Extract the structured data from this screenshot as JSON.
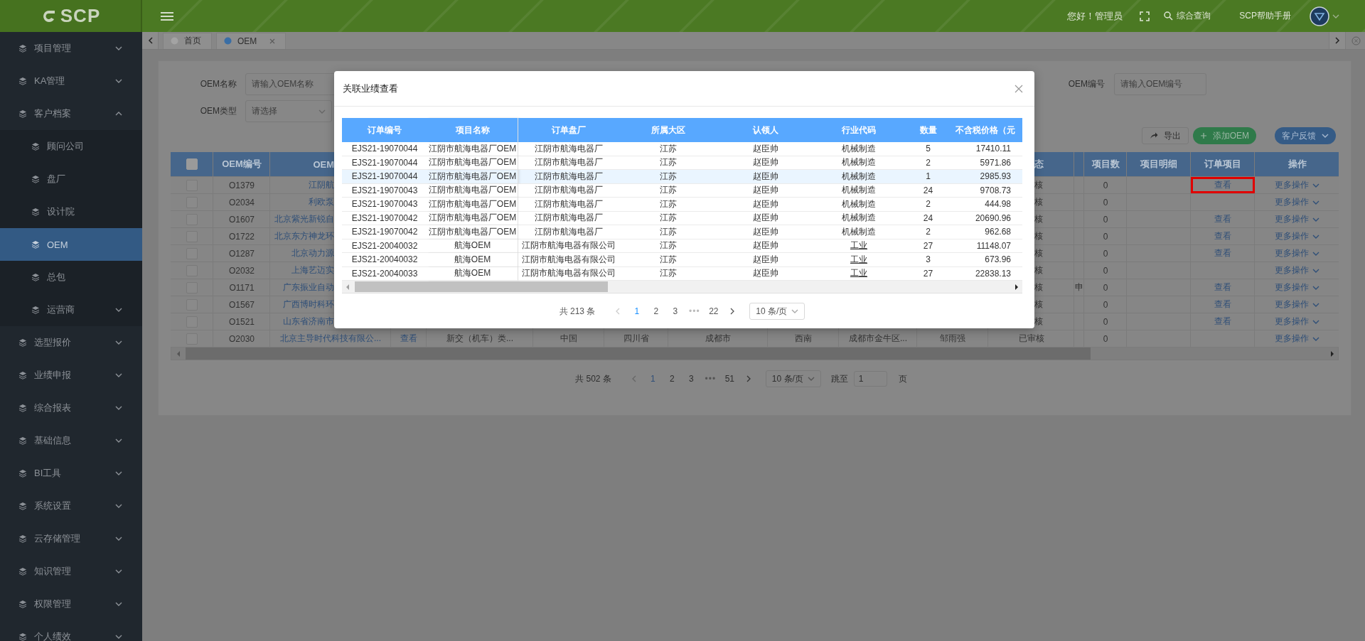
{
  "logo": {
    "text": "SCP"
  },
  "header": {
    "greeting": "您好！管理员",
    "search_label": "综合查询",
    "help_link": "SCP帮助手册"
  },
  "sidebar": {
    "items": [
      {
        "label": "项目管理",
        "expanded": false,
        "selected": false
      },
      {
        "label": "KA管理",
        "expanded": false,
        "selected": false
      },
      {
        "label": "客户档案",
        "expanded": true,
        "selected": false,
        "children": [
          {
            "label": "顾问公司",
            "selected": false
          },
          {
            "label": "盘厂",
            "selected": false
          },
          {
            "label": "设计院",
            "selected": false
          },
          {
            "label": "OEM",
            "selected": true
          },
          {
            "label": "总包",
            "selected": false
          },
          {
            "label": "运营商",
            "expanded": false,
            "selected": false
          }
        ]
      },
      {
        "label": "选型报价",
        "expanded": false,
        "selected": false
      },
      {
        "label": "业绩申报",
        "expanded": false,
        "selected": false
      },
      {
        "label": "综合报表",
        "expanded": false,
        "selected": false
      },
      {
        "label": "基础信息",
        "expanded": false,
        "selected": false
      },
      {
        "label": "BI工具",
        "expanded": false,
        "selected": false
      },
      {
        "label": "系统设置",
        "expanded": false,
        "selected": false
      },
      {
        "label": "云存储管理",
        "expanded": false,
        "selected": false
      },
      {
        "label": "知识管理",
        "expanded": false,
        "selected": false
      },
      {
        "label": "权限管理",
        "expanded": false,
        "selected": false
      },
      {
        "label": "个人绩效",
        "expanded": false,
        "selected": false
      }
    ]
  },
  "tabs": [
    {
      "label": "首页",
      "selected": false,
      "closable": false
    },
    {
      "label": "OEM",
      "selected": true,
      "closable": true
    }
  ],
  "filters": [
    {
      "label": "OEM名称",
      "placeholder": "请输入OEM名称",
      "kind": "input"
    },
    {
      "label": "OEM类型",
      "placeholder": "请选择",
      "kind": "select"
    },
    {
      "label": "OEM编号",
      "placeholder": "请输入OEM编号",
      "kind": "input"
    }
  ],
  "toolbar": {
    "buttons": [
      {
        "label": "导出",
        "kind": "export"
      },
      {
        "label": "添加OEM",
        "kind": "add"
      },
      {
        "label": "客户反馈",
        "kind": "dropdown"
      }
    ]
  },
  "table": {
    "header": {
      "select_all_checked": false,
      "oem_no": "OEM编号",
      "oem_name": "OEM",
      "status": "态",
      "project_count": "项目数",
      "project_detail": "项目明细",
      "order_items": "订单项目",
      "action": "操作"
    },
    "rows": [
      {
        "kind": "covered",
        "checked": false,
        "oem_no": "O1379",
        "oem_name": "江阴航",
        "status": "核",
        "project_count": "0",
        "order_items": "查看",
        "order_link_highlighted": true,
        "action": "更多操作"
      },
      {
        "kind": "covered",
        "checked": false,
        "oem_no": "O2034",
        "oem_name": "利欧泵",
        "status": "核",
        "project_count": "0",
        "order_link_highlighted": false,
        "action": "更多操作"
      },
      {
        "kind": "covered",
        "checked": false,
        "oem_no": "O1607",
        "oem_name": "北京紫光新锐自",
        "status": "核",
        "project_count": "0",
        "order_items": "查看",
        "order_link_highlighted": false,
        "action": "更多操作"
      },
      {
        "kind": "covered",
        "checked": false,
        "oem_no": "O1722",
        "oem_name": "北京东方神龙环",
        "status": "核",
        "project_count": "0",
        "order_items": "查看",
        "order_link_highlighted": false,
        "action": "更多操作"
      },
      {
        "kind": "covered",
        "checked": false,
        "oem_no": "O1287",
        "oem_name": "北京动力源",
        "status": "核",
        "project_count": "0",
        "order_items": "查看",
        "order_link_highlighted": false,
        "action": "更多操作"
      },
      {
        "kind": "covered",
        "checked": false,
        "oem_no": "O2032",
        "oem_name": "上海艺迈实",
        "status": "核",
        "project_count": "0",
        "order_link_highlighted": false,
        "action": "更多操作"
      },
      {
        "kind": "covered",
        "checked": false,
        "oem_no": "O1171",
        "oem_name": "广东振业自动",
        "status": "核",
        "column_13": "申",
        "project_count": "0",
        "order_items": "查看",
        "order_link_highlighted": false,
        "action": "更多操作"
      },
      {
        "kind": "covered",
        "checked": false,
        "oem_no": "O1567",
        "oem_name": "广西博时科环",
        "status": "核",
        "project_count": "0",
        "order_items": "查看",
        "order_link_highlighted": false,
        "action": "更多操作"
      },
      {
        "kind": "covered",
        "checked": false,
        "oem_no": "O1521",
        "oem_name": "山东省济南市",
        "status": "核",
        "project_count": "0",
        "order_items": "查看",
        "order_link_highlighted": false,
        "action": "更多操作"
      },
      {
        "kind": "full",
        "checked": false,
        "oem_no": "O2030",
        "oem_name": "北京主导时代科技有限公...",
        "column_4": "查看",
        "column_5": "新交（机车）类...",
        "column_6": "中国",
        "column_7": "四川省",
        "column_8": "成都市",
        "column_9": "西南",
        "column_10": "成都市金牛区...",
        "column_11": "邹雨强",
        "status": "已审核",
        "project_count": "0",
        "order_link_highlighted": false,
        "action": "更多操作"
      }
    ]
  },
  "pagination": {
    "total": "共 502 条",
    "pages": [
      {
        "label": "1",
        "kind": "page",
        "selected": true
      },
      {
        "label": "2",
        "kind": "page",
        "selected": false
      },
      {
        "label": "3",
        "kind": "page",
        "selected": false
      },
      {
        "label": "•••",
        "kind": "ellipsis",
        "selected": false
      },
      {
        "label": "51",
        "kind": "page",
        "selected": false
      }
    ],
    "page_size": "10 条/页",
    "jump_label": "跳至",
    "jump_value": "1",
    "page_suffix": "页"
  },
  "modal": {
    "title": "关联业绩查看",
    "columns": [
      "订单编号",
      "项目名称",
      "订单盘厂",
      "所属大区",
      "认领人",
      "行业代码",
      "数量",
      "不含税价格（元"
    ],
    "rows": [
      {
        "hovered": false,
        "industry_is_link": false,
        "cells": [
          "EJS21-19070044",
          "江阴市航海电器厂OEM",
          "江阴市航海电器厂",
          "江苏",
          "赵臣帅",
          "机械制造",
          "5",
          "17410.11"
        ]
      },
      {
        "hovered": false,
        "industry_is_link": false,
        "cells": [
          "EJS21-19070044",
          "江阴市航海电器厂OEM",
          "江阴市航海电器厂",
          "江苏",
          "赵臣帅",
          "机械制造",
          "2",
          "5971.86"
        ]
      },
      {
        "hovered": true,
        "industry_is_link": false,
        "cells": [
          "EJS21-19070044",
          "江阴市航海电器厂OEM",
          "江阴市航海电器厂",
          "江苏",
          "赵臣帅",
          "机械制造",
          "1",
          "2985.93"
        ]
      },
      {
        "hovered": false,
        "industry_is_link": false,
        "cells": [
          "EJS21-19070043",
          "江阴市航海电器厂OEM",
          "江阴市航海电器厂",
          "江苏",
          "赵臣帅",
          "机械制造",
          "24",
          "9708.73"
        ]
      },
      {
        "hovered": false,
        "industry_is_link": false,
        "cells": [
          "EJS21-19070043",
          "江阴市航海电器厂OEM",
          "江阴市航海电器厂",
          "江苏",
          "赵臣帅",
          "机械制造",
          "2",
          "444.98"
        ]
      },
      {
        "hovered": false,
        "industry_is_link": false,
        "cells": [
          "EJS21-19070042",
          "江阴市航海电器厂OEM",
          "江阴市航海电器厂",
          "江苏",
          "赵臣帅",
          "机械制造",
          "24",
          "20690.96"
        ]
      },
      {
        "hovered": false,
        "industry_is_link": false,
        "cells": [
          "EJS21-19070042",
          "江阴市航海电器厂OEM",
          "江阴市航海电器厂",
          "江苏",
          "赵臣帅",
          "机械制造",
          "2",
          "962.68"
        ]
      },
      {
        "hovered": false,
        "industry_is_link": true,
        "cells": [
          "EJS21-20040032",
          "航海OEM",
          "江阴市航海电器有限公司",
          "江苏",
          "赵臣帅",
          "工业",
          "27",
          "11148.07"
        ]
      },
      {
        "hovered": false,
        "industry_is_link": true,
        "cells": [
          "EJS21-20040032",
          "航海OEM",
          "江阴市航海电器有限公司",
          "江苏",
          "赵臣帅",
          "工业",
          "3",
          "673.96"
        ]
      },
      {
        "hovered": false,
        "industry_is_link": true,
        "cells": [
          "EJS21-20040033",
          "航海OEM",
          "江阴市航海电器有限公司",
          "江苏",
          "赵臣帅",
          "工业",
          "27",
          "22838.13"
        ]
      }
    ],
    "pagination": {
      "total": "共 213 条",
      "pages": [
        {
          "label": "1",
          "kind": "page",
          "selected": true
        },
        {
          "label": "2",
          "kind": "page",
          "selected": false
        },
        {
          "label": "3",
          "kind": "page",
          "selected": false
        },
        {
          "label": "•••",
          "kind": "ellipsis",
          "selected": false
        },
        {
          "label": "22",
          "kind": "page",
          "selected": false
        }
      ],
      "page_size": "10 条/页"
    }
  }
}
